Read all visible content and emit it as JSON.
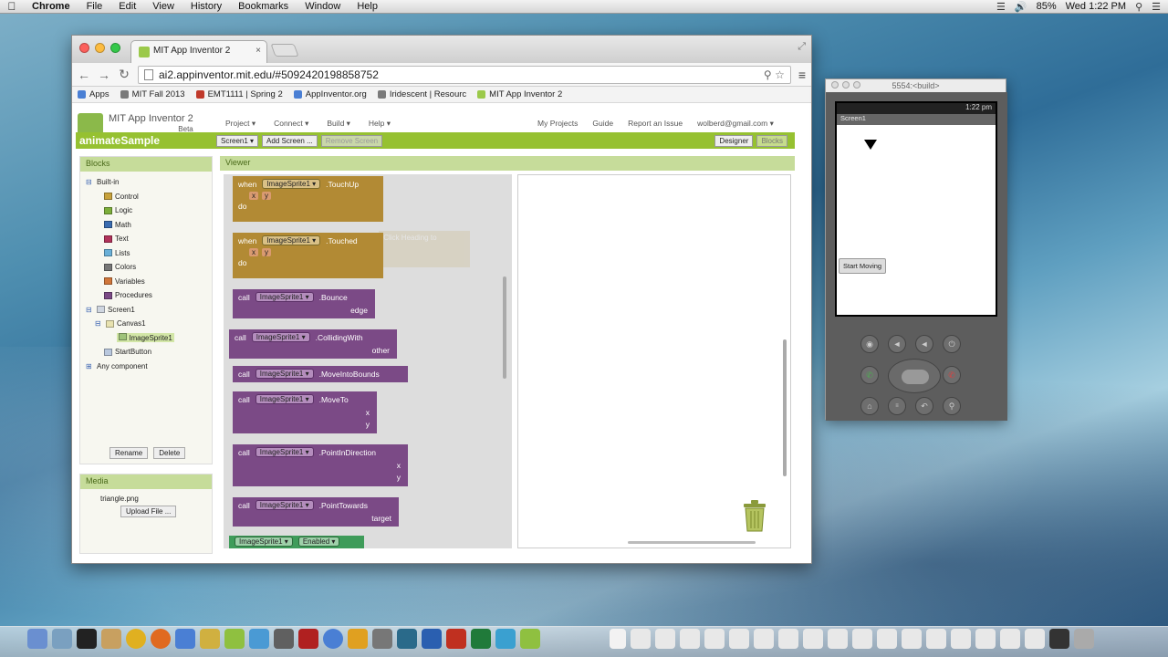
{
  "menubar": {
    "app": "Chrome",
    "items": [
      "File",
      "Edit",
      "View",
      "History",
      "Bookmarks",
      "Window",
      "Help"
    ],
    "battery": "85%",
    "clock": "Wed 1:22 PM"
  },
  "browser": {
    "tab_title": "MIT App Inventor 2",
    "url": "ai2.appinventor.mit.edu/#5092420198858752",
    "bookmarks": [
      {
        "label": "Apps",
        "color": "#4a7fd4"
      },
      {
        "label": "MIT Fall 2013",
        "color": "#7a7a7a"
      },
      {
        "label": "EMT1111 | Spring 2",
        "color": "#c03a2b"
      },
      {
        "label": "AppInventor.org",
        "color": "#4a7fd4"
      },
      {
        "label": "Iridescent | Resourc",
        "color": "#7a7a7a"
      },
      {
        "label": "MIT App Inventor 2",
        "color": "#9bc94a"
      }
    ]
  },
  "appinventor": {
    "logo_title": "MIT App Inventor 2",
    "beta": "Beta",
    "nav": [
      "Project ▾",
      "Connect ▾",
      "Build ▾",
      "Help ▾"
    ],
    "nav_right": [
      "My Projects",
      "Guide",
      "Report an Issue",
      "wolberd@gmail.com ▾"
    ],
    "project_name": "animateSample",
    "toolbar": {
      "screen": "Screen1 ▾",
      "add_screen": "Add Screen ...",
      "remove_screen": "Remove Screen",
      "designer": "Designer",
      "blocks": "Blocks"
    },
    "blocks_panel": {
      "title": "Blocks",
      "builtin": "Built-in",
      "builtin_items": [
        {
          "label": "Control",
          "color": "#c8a23c"
        },
        {
          "label": "Logic",
          "color": "#7cae3a"
        },
        {
          "label": "Math",
          "color": "#3a6cb0"
        },
        {
          "label": "Text",
          "color": "#b0325a"
        },
        {
          "label": "Lists",
          "color": "#6ab0d8"
        },
        {
          "label": "Colors",
          "color": "#777777"
        },
        {
          "label": "Variables",
          "color": "#d0763a"
        },
        {
          "label": "Procedures",
          "color": "#7b4a86"
        }
      ],
      "screen": "Screen1",
      "canvas": "Canvas1",
      "sprite": "ImageSprite1",
      "startbutton": "StartButton",
      "any": "Any component",
      "rename": "Rename",
      "delete": "Delete"
    },
    "media": {
      "title": "Media",
      "file": "triangle.png",
      "upload": "Upload File ..."
    },
    "viewer": {
      "title": "Viewer",
      "blocks": {
        "touchup": {
          "kw": "when",
          "comp": "ImageSprite1 ▾",
          "evt": ".TouchUp",
          "p1": "x",
          "p2": "y",
          "do": "do"
        },
        "touched": {
          "kw": "when",
          "comp": "ImageSprite1 ▾",
          "evt": ".Touched",
          "p1": "x",
          "p2": "y",
          "do": "do"
        },
        "bounce": {
          "kw": "call",
          "comp": "ImageSprite1 ▾",
          "method": ".Bounce",
          "args": [
            "edge"
          ]
        },
        "colliding": {
          "kw": "call",
          "comp": "ImageSprite1 ▾",
          "method": ".CollidingWith",
          "args": [
            "other"
          ]
        },
        "moveinto": {
          "kw": "call",
          "comp": "ImageSprite1 ▾",
          "method": ".MoveIntoBounds",
          "args": []
        },
        "moveto": {
          "kw": "call",
          "comp": "ImageSprite1 ▾",
          "method": ".MoveTo",
          "args": [
            "x",
            "y"
          ]
        },
        "pointdir": {
          "kw": "call",
          "comp": "ImageSprite1 ▾",
          "method": ".PointInDirection",
          "args": [
            "x",
            "y"
          ]
        },
        "pointtowards": {
          "kw": "call",
          "comp": "ImageSprite1 ▾",
          "method": ".PointTowards",
          "args": [
            "target"
          ]
        },
        "enabled": {
          "comp": "ImageSprite1 ▾",
          "prop": "Enabled ▾"
        }
      },
      "ghost": {
        "evt": ".Click",
        "prop": "Heading",
        "to": "to"
      }
    }
  },
  "emulator": {
    "title": "5554:<build>",
    "clock": "1:22 pm",
    "screen_title": "Screen1",
    "start_button": "Start Moving"
  }
}
